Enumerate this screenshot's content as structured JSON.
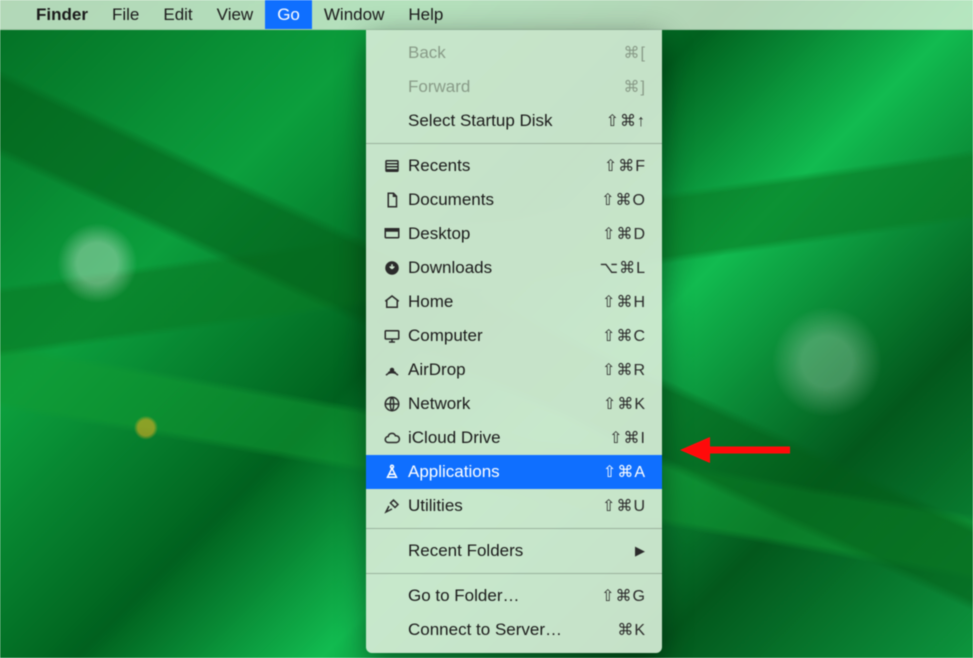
{
  "menubar": {
    "apple": "",
    "app": "Finder",
    "items": [
      "File",
      "Edit",
      "View",
      "Go",
      "Window",
      "Help"
    ],
    "active": "Go"
  },
  "menu": {
    "section1": [
      {
        "label": "Back",
        "shortcut": "⌘[",
        "disabled": true
      },
      {
        "label": "Forward",
        "shortcut": "⌘]",
        "disabled": true
      },
      {
        "label": "Select Startup Disk",
        "shortcut": "⇧⌘↑"
      }
    ],
    "section2": [
      {
        "icon": "recents",
        "label": "Recents",
        "shortcut": "⇧⌘F"
      },
      {
        "icon": "documents",
        "label": "Documents",
        "shortcut": "⇧⌘O"
      },
      {
        "icon": "desktop",
        "label": "Desktop",
        "shortcut": "⇧⌘D"
      },
      {
        "icon": "downloads",
        "label": "Downloads",
        "shortcut": "⌥⌘L"
      },
      {
        "icon": "home",
        "label": "Home",
        "shortcut": "⇧⌘H"
      },
      {
        "icon": "computer",
        "label": "Computer",
        "shortcut": "⇧⌘C"
      },
      {
        "icon": "airdrop",
        "label": "AirDrop",
        "shortcut": "⇧⌘R"
      },
      {
        "icon": "network",
        "label": "Network",
        "shortcut": "⇧⌘K"
      },
      {
        "icon": "icloud",
        "label": "iCloud Drive",
        "shortcut": "⇧⌘I"
      },
      {
        "icon": "apps",
        "label": "Applications",
        "shortcut": "⇧⌘A",
        "highlight": true
      },
      {
        "icon": "utilities",
        "label": "Utilities",
        "shortcut": "⇧⌘U"
      }
    ],
    "section3": [
      {
        "label": "Recent Folders",
        "submenu": true
      }
    ],
    "section4": [
      {
        "label": "Go to Folder…",
        "shortcut": "⇧⌘G"
      },
      {
        "label": "Connect to Server…",
        "shortcut": "⌘K"
      }
    ]
  }
}
